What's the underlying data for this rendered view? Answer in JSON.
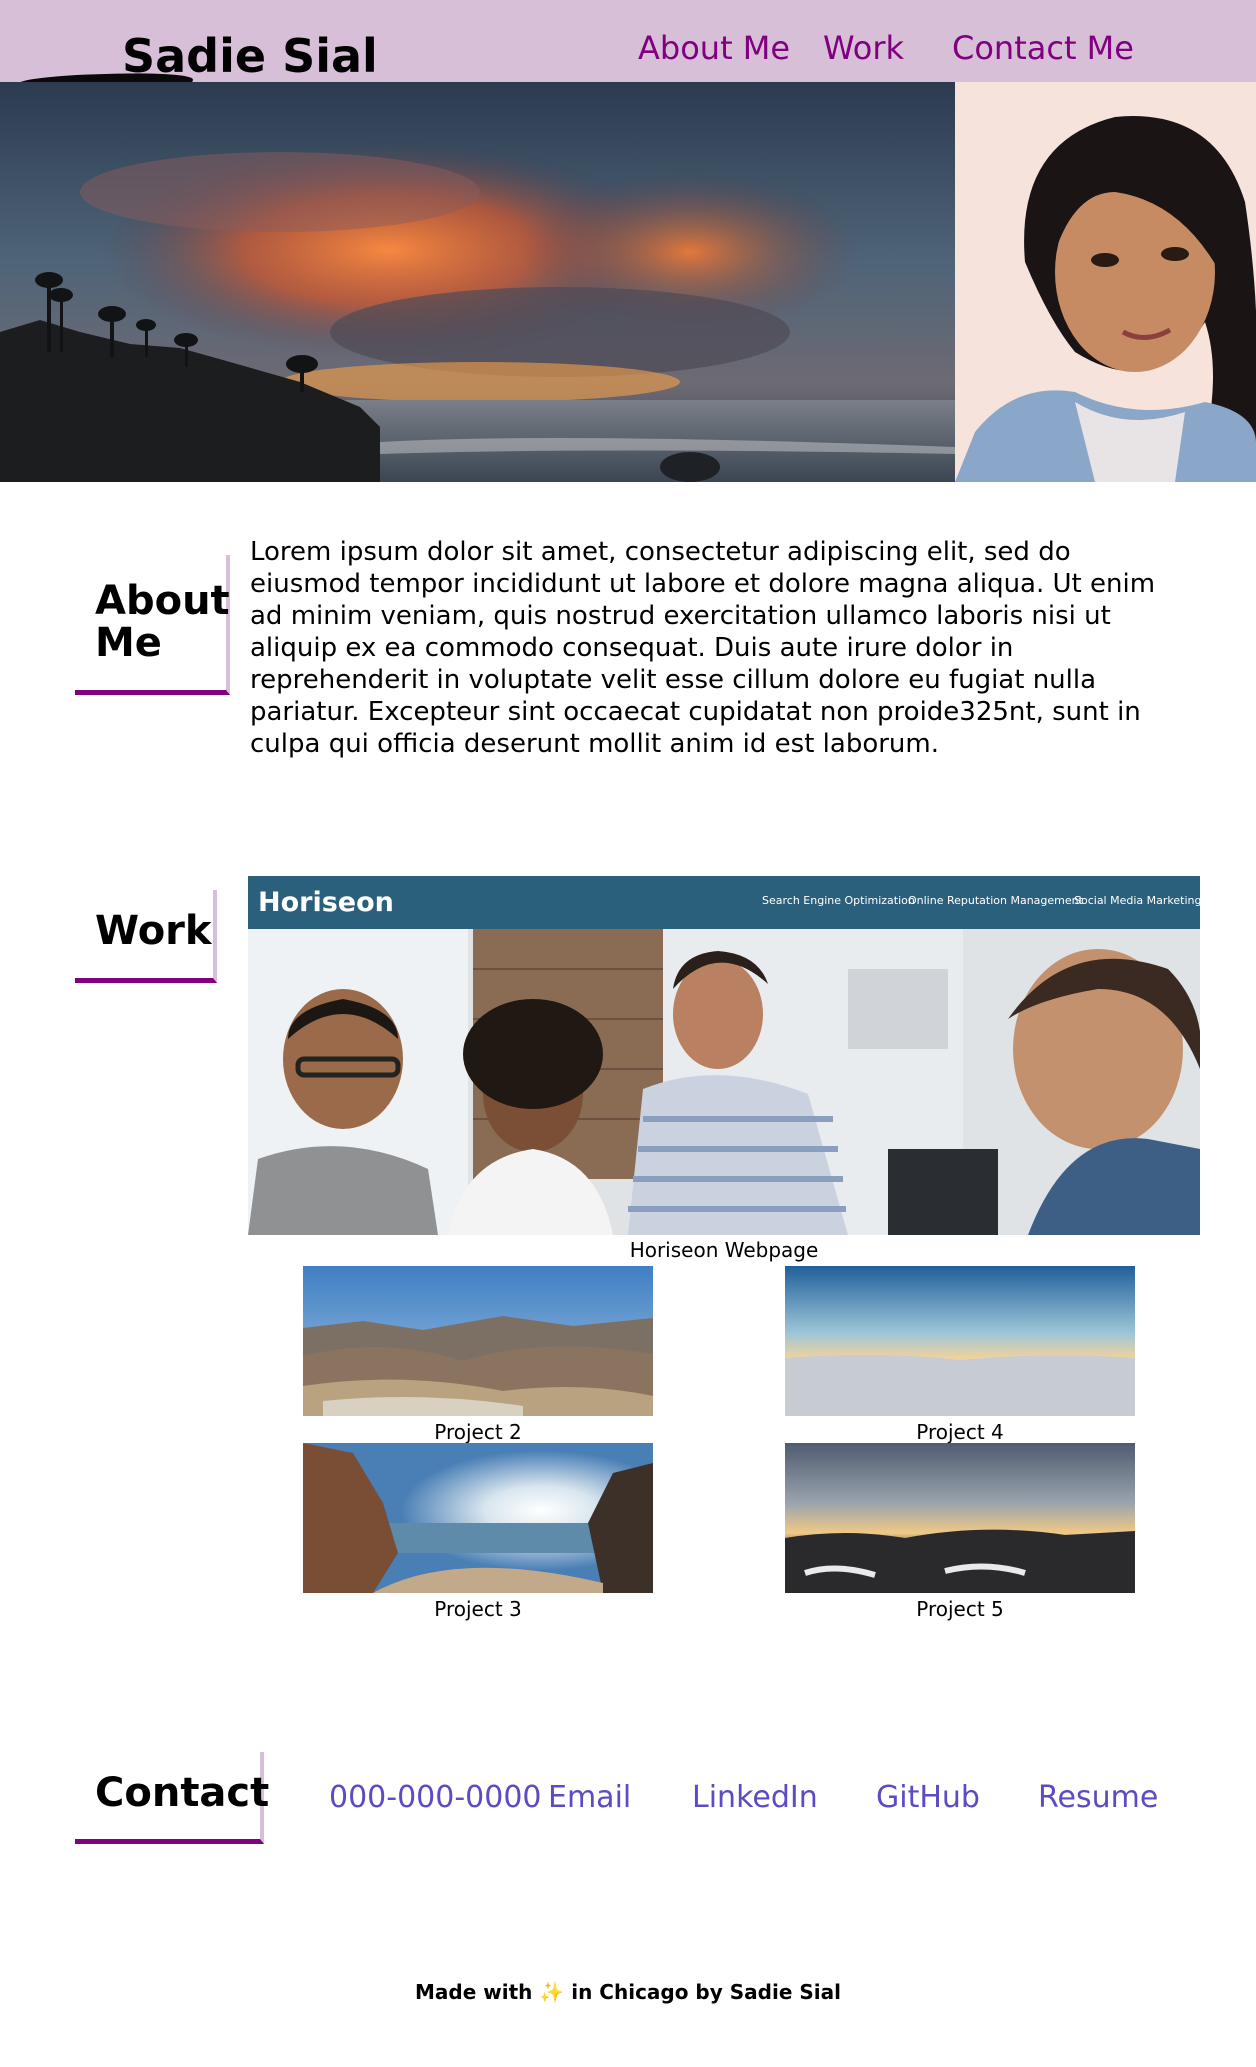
{
  "header": {
    "brand": "Sadie Sial",
    "nav": [
      "About Me",
      "Work",
      "Contact Me"
    ]
  },
  "about": {
    "heading_line1": "About",
    "heading_line2": "Me",
    "body": "Lorem ipsum dolor sit amet, consectetur adipiscing elit, sed do eiusmod tempor incididunt ut labore et dolore magna aliqua. Ut enim ad minim veniam, quis nostrud exercitation ullamco laboris nisi ut aliquip ex ea commodo consequat. Duis aute irure dolor in reprehenderit in voluptate velit esse cillum dolore eu fugiat nulla pariatur. Excepteur sint occaecat cupidatat non proide325nt, sunt in culpa qui officia deserunt mollit anim id est laborum."
  },
  "work": {
    "heading": "Work",
    "featured": {
      "logo": "Horiseon",
      "links": [
        "Search Engine Optimization",
        "Online Reputation Management",
        "Social Media Marketing"
      ],
      "caption": "Horiseon Webpage"
    },
    "projects": [
      {
        "caption": "Project 2",
        "scene": "desert-mountains"
      },
      {
        "caption": "Project 4",
        "scene": "above-clouds"
      },
      {
        "caption": "Project 3",
        "scene": "beach-cliffs"
      },
      {
        "caption": "Project 5",
        "scene": "sunset-hills"
      }
    ]
  },
  "contact": {
    "heading": "Contact",
    "links": [
      "000-000-0000",
      "Email",
      "LinkedIn",
      "GitHub",
      "Resume"
    ]
  },
  "footer": {
    "before": "Made with",
    "emoji": "✨",
    "after": "in Chicago by Sadie Sial"
  },
  "colors": {
    "header_bg": "#d8bfd8",
    "nav_text": "#800080",
    "heading_underline": "#800080",
    "heading_border": "#d8bfd8",
    "contact_link": "#5b4bc4",
    "horiseon_bar": "#2a607c"
  }
}
